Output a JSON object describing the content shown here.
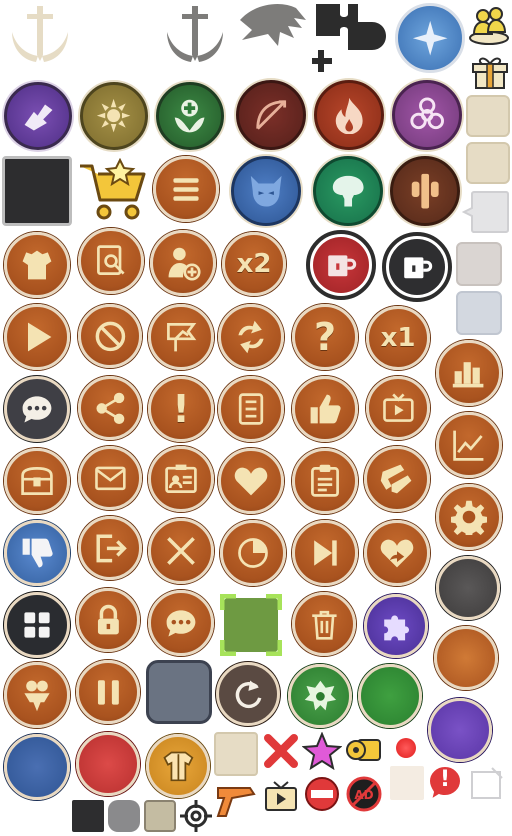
{
  "sheet": {
    "labels": {
      "x2": "x2",
      "x1": "x1",
      "question": "?",
      "exclaim": "!",
      "alert": "!"
    },
    "colors": {
      "orange": "#a9531f",
      "cream": "#f4e3b3",
      "purple": "#5b3a8f",
      "gold": "#8d7a38",
      "green": "#2f7d3a",
      "maroon": "#6b2a22",
      "rust": "#a23a1e",
      "blue": "#3f6fb5",
      "teal": "#1e7a4e",
      "red": "#c8363a",
      "slate": "#6a7382"
    },
    "icons": [
      "sword-emblem-faded-icon",
      "sword-emblem-icon",
      "dragon-silhouette-icon",
      "puzzle-add-icon",
      "star-crest-icon",
      "players-icon",
      "gift-icon",
      "hook-attack-icon",
      "sun-emblem-icon",
      "heal-icon",
      "bow-icon",
      "fire-icon",
      "biohazard-icon",
      "shop-cart-icon",
      "menu-icon",
      "demon-mask-icon",
      "tree-icon",
      "totem-icon",
      "armor-icon",
      "search-profile-icon",
      "add-user-icon",
      "mug-icon",
      "mug-alt-icon",
      "play-icon",
      "block-icon",
      "achievement-icon",
      "refresh-arrows-icon",
      "help-icon",
      "chat-icon",
      "share-icon",
      "notice-icon",
      "quest-list-icon",
      "like-icon",
      "watch-ad-icon",
      "chest-icon",
      "mail-icon",
      "id-card-icon",
      "heart-icon",
      "clipboard-icon",
      "weapons-icon",
      "dislike-icon",
      "logout-icon",
      "battle-icon",
      "pie-chart-icon",
      "skip-icon",
      "heart-share-icon",
      "grid-icon",
      "lock-icon",
      "chat-bubble-icon",
      "trash-icon",
      "puzzle-icon",
      "clan-icon",
      "pause-icon",
      "restart-icon",
      "guild-crest-icon",
      "jacket-icon",
      "close-x-icon",
      "star-burst-icon",
      "key-icon",
      "pistol-icon",
      "tv-icon",
      "no-entry-icon",
      "no-ads-icon",
      "alert-icon",
      "target-icon",
      "leaderboard-icon",
      "stats-icon",
      "settings-icon"
    ]
  }
}
